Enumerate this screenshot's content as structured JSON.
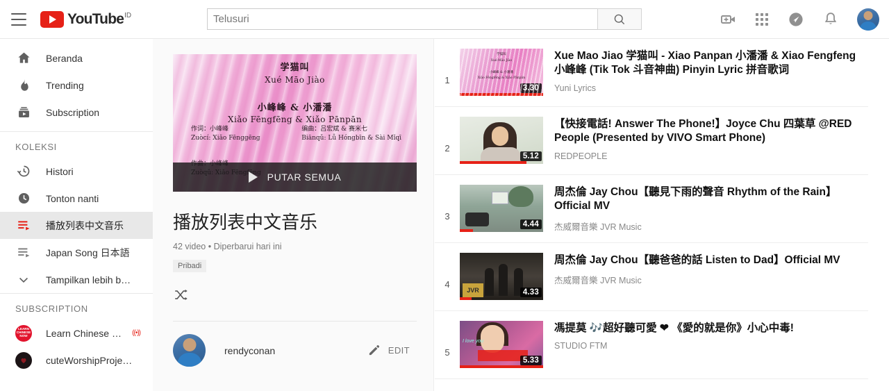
{
  "topbar": {
    "menu_icon": "hamburger-menu-icon",
    "logo_text": "YouTube",
    "logo_country": "ID",
    "search": {
      "value": "",
      "placeholder": "Telusuri"
    },
    "search_icon": "search-icon",
    "icons": [
      {
        "name": "upload-video-icon",
        "label": "Upload"
      },
      {
        "name": "apps-grid-icon",
        "label": "YouTube apps"
      },
      {
        "name": "messages-icon",
        "label": "Messages"
      },
      {
        "name": "notifications-bell-icon",
        "label": "Notifications"
      }
    ],
    "avatar": "account-avatar"
  },
  "sidebar": {
    "main_items": [
      {
        "label": "Beranda",
        "icon": "home-icon",
        "active": false
      },
      {
        "label": "Trending",
        "icon": "trending-flame-icon",
        "active": false
      },
      {
        "label": "Subscription",
        "icon": "subscriptions-icon",
        "active": false
      }
    ],
    "collections_header": "KOLEKSI",
    "collection_items": [
      {
        "label": "Histori",
        "icon": "history-clock-icon",
        "active": false
      },
      {
        "label": "Tonton nanti",
        "icon": "watch-later-clock-icon",
        "active": false
      },
      {
        "label": "播放列表中文音乐",
        "icon": "playlist-icon",
        "active": true
      },
      {
        "label": "Japan Song 日本語",
        "icon": "playlist-icon",
        "active": false
      },
      {
        "label": "Tampilkan lebih b…",
        "icon": "chevron-down-icon",
        "active": false
      }
    ],
    "subscription_header": "SUBSCRIPTION",
    "subscriptions": [
      {
        "label": "Learn Chinese …",
        "avatar_text": "LEARN CHINESE NOW",
        "avatar_color": "#e2142d",
        "live": true,
        "live_badge": "((•))"
      },
      {
        "label": "cuteWorshipProje…",
        "avatar_text": "",
        "avatar_color": "#1c1416",
        "live": false,
        "live_badge": ""
      }
    ]
  },
  "playlist": {
    "thumbnail": {
      "line1": "学猫叫",
      "line2": "Xué Māo Jiào",
      "line3": "小峰峰 & 小潘潘",
      "line4": "Xiǎo Fēngfēng & Xiǎo Pānpān",
      "credit_left_1": "作词：小峰峰",
      "credit_left_2": "Zuòcí: Xiǎo Fēnggēng",
      "credit_right_1": "编曲：吕宏斌 & 赛米七",
      "credit_right_2": "Biānqǔ: Lǚ Hóngbīn & Sài Mǐqī",
      "credit_bottom_1": "作曲：小峰峰",
      "credit_bottom_2": "Zuòqǔ: Xiǎo Fēngfēng"
    },
    "play_all_label": "PUTAR SEMUA",
    "play_icon": "play-triangle-icon",
    "title": "播放列表中文音乐",
    "meta": "42 video • Diperbarui hari ini",
    "privacy_badge": "Pribadi",
    "shuffle_icon": "shuffle-icon",
    "owner_name": "rendyconan",
    "owner_avatar": "owner-avatar",
    "edit_label": "EDIT",
    "edit_icon": "pencil-edit-icon"
  },
  "videos": [
    {
      "index": "1",
      "title": "Xue Mao Jiao 学猫叫 - Xiao Panpan 小潘潘 & Xiao Fengfeng 小峰峰 (Tik Tok 斗音神曲) Pinyin Lyric 拼音歌词",
      "channel": "Yuni Lyrics",
      "duration": "3.30",
      "progress_percent": 100,
      "thumb_class": "t1",
      "thumb_mini": "学猫叫\nXué Māo Jiào\n小峰峰 & 小潘潘\nXiǎo Fēngfēng & Xiǎo Pānpān"
    },
    {
      "index": "2",
      "title": "【快接電話! Answer The Phone!】Joyce Chu 四葉草 @RED People (Presented by VIVO Smart Phone)",
      "channel": "REDPEOPLE",
      "duration": "5.12",
      "progress_percent": 80,
      "thumb_class": "t2",
      "thumb_mini": ""
    },
    {
      "index": "3",
      "title": "周杰倫 Jay Chou【聽見下雨的聲音 Rhythm of the Rain】Official MV",
      "channel": "杰威爾音樂 JVR Music",
      "duration": "4.44",
      "progress_percent": 16,
      "thumb_class": "t3",
      "thumb_mini": ""
    },
    {
      "index": "4",
      "title": "周杰倫 Jay Chou【聽爸爸的話 Listen to Dad】Official MV",
      "channel": "杰威爾音樂 JVR Music",
      "duration": "4.33",
      "progress_percent": 14,
      "thumb_class": "t4",
      "thumb_mini": ""
    },
    {
      "index": "5",
      "title": "馮提莫 🎶超好聽可愛 ❤ 《愛的就是你》小心中毒!",
      "channel": "STUDIO FTM",
      "duration": "5.33",
      "progress_percent": 100,
      "thumb_class": "t5",
      "thumb_mini": ""
    }
  ],
  "colors": {
    "brand_red": "#e62117",
    "active_bg": "#e8e8e8",
    "panel_bg": "#fafafa"
  }
}
